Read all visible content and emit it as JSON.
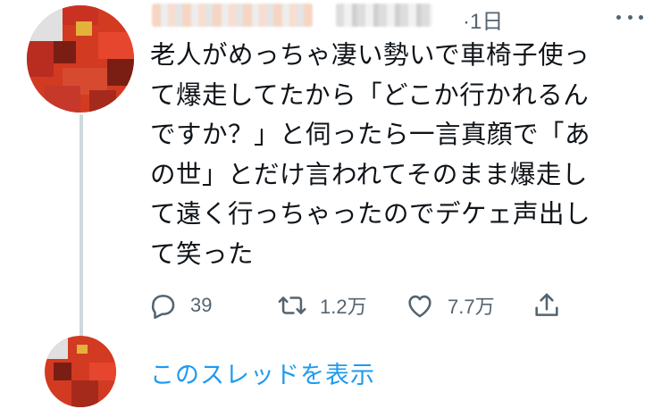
{
  "header": {
    "time": "·1日"
  },
  "tweet": {
    "text": "老人がめっちゃ凄い勢いで車椅子使っ\nて爆走してたから「どこか行かれるん\nですか？」と伺ったら一言真顔で「あ\nの世」とだけ言われてそのまま爆走し\nて遠く行っちゃったのでデケェ声出し\nて笑った"
  },
  "actions": {
    "reply_count": "39",
    "retweet_count": "1.2万",
    "like_count": "7.7万"
  },
  "icons": {
    "reply": "reply-icon",
    "retweet": "retweet-icon",
    "like": "heart-icon",
    "share": "share-icon",
    "more": "more-icon"
  },
  "colors": {
    "accent": "#1d9bf0",
    "muted": "#536471",
    "text": "#0f1419",
    "thread_line": "#cfd9de"
  },
  "thread": {
    "show_label": "このスレッドを表示"
  }
}
